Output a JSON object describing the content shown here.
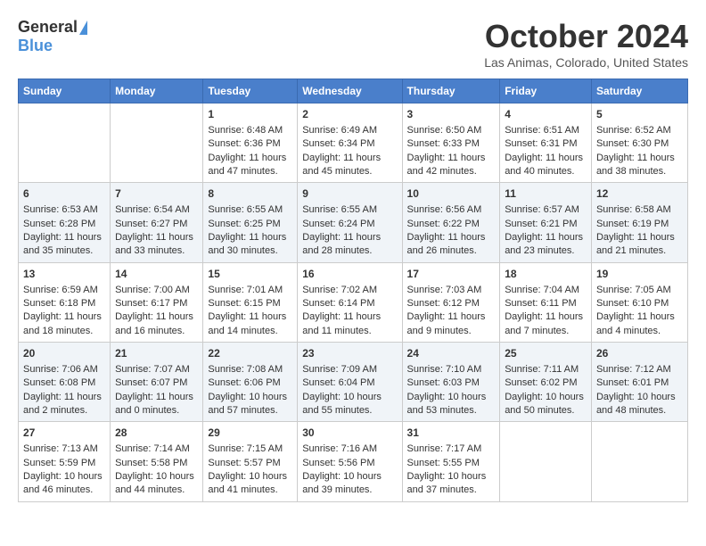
{
  "header": {
    "logo_general": "General",
    "logo_blue": "Blue",
    "month_title": "October 2024",
    "location": "Las Animas, Colorado, United States"
  },
  "days_of_week": [
    "Sunday",
    "Monday",
    "Tuesday",
    "Wednesday",
    "Thursday",
    "Friday",
    "Saturday"
  ],
  "weeks": [
    [
      {
        "day": "",
        "content": ""
      },
      {
        "day": "",
        "content": ""
      },
      {
        "day": "1",
        "content": "Sunrise: 6:48 AM\nSunset: 6:36 PM\nDaylight: 11 hours and 47 minutes."
      },
      {
        "day": "2",
        "content": "Sunrise: 6:49 AM\nSunset: 6:34 PM\nDaylight: 11 hours and 45 minutes."
      },
      {
        "day": "3",
        "content": "Sunrise: 6:50 AM\nSunset: 6:33 PM\nDaylight: 11 hours and 42 minutes."
      },
      {
        "day": "4",
        "content": "Sunrise: 6:51 AM\nSunset: 6:31 PM\nDaylight: 11 hours and 40 minutes."
      },
      {
        "day": "5",
        "content": "Sunrise: 6:52 AM\nSunset: 6:30 PM\nDaylight: 11 hours and 38 minutes."
      }
    ],
    [
      {
        "day": "6",
        "content": "Sunrise: 6:53 AM\nSunset: 6:28 PM\nDaylight: 11 hours and 35 minutes."
      },
      {
        "day": "7",
        "content": "Sunrise: 6:54 AM\nSunset: 6:27 PM\nDaylight: 11 hours and 33 minutes."
      },
      {
        "day": "8",
        "content": "Sunrise: 6:55 AM\nSunset: 6:25 PM\nDaylight: 11 hours and 30 minutes."
      },
      {
        "day": "9",
        "content": "Sunrise: 6:55 AM\nSunset: 6:24 PM\nDaylight: 11 hours and 28 minutes."
      },
      {
        "day": "10",
        "content": "Sunrise: 6:56 AM\nSunset: 6:22 PM\nDaylight: 11 hours and 26 minutes."
      },
      {
        "day": "11",
        "content": "Sunrise: 6:57 AM\nSunset: 6:21 PM\nDaylight: 11 hours and 23 minutes."
      },
      {
        "day": "12",
        "content": "Sunrise: 6:58 AM\nSunset: 6:19 PM\nDaylight: 11 hours and 21 minutes."
      }
    ],
    [
      {
        "day": "13",
        "content": "Sunrise: 6:59 AM\nSunset: 6:18 PM\nDaylight: 11 hours and 18 minutes."
      },
      {
        "day": "14",
        "content": "Sunrise: 7:00 AM\nSunset: 6:17 PM\nDaylight: 11 hours and 16 minutes."
      },
      {
        "day": "15",
        "content": "Sunrise: 7:01 AM\nSunset: 6:15 PM\nDaylight: 11 hours and 14 minutes."
      },
      {
        "day": "16",
        "content": "Sunrise: 7:02 AM\nSunset: 6:14 PM\nDaylight: 11 hours and 11 minutes."
      },
      {
        "day": "17",
        "content": "Sunrise: 7:03 AM\nSunset: 6:12 PM\nDaylight: 11 hours and 9 minutes."
      },
      {
        "day": "18",
        "content": "Sunrise: 7:04 AM\nSunset: 6:11 PM\nDaylight: 11 hours and 7 minutes."
      },
      {
        "day": "19",
        "content": "Sunrise: 7:05 AM\nSunset: 6:10 PM\nDaylight: 11 hours and 4 minutes."
      }
    ],
    [
      {
        "day": "20",
        "content": "Sunrise: 7:06 AM\nSunset: 6:08 PM\nDaylight: 11 hours and 2 minutes."
      },
      {
        "day": "21",
        "content": "Sunrise: 7:07 AM\nSunset: 6:07 PM\nDaylight: 11 hours and 0 minutes."
      },
      {
        "day": "22",
        "content": "Sunrise: 7:08 AM\nSunset: 6:06 PM\nDaylight: 10 hours and 57 minutes."
      },
      {
        "day": "23",
        "content": "Sunrise: 7:09 AM\nSunset: 6:04 PM\nDaylight: 10 hours and 55 minutes."
      },
      {
        "day": "24",
        "content": "Sunrise: 7:10 AM\nSunset: 6:03 PM\nDaylight: 10 hours and 53 minutes."
      },
      {
        "day": "25",
        "content": "Sunrise: 7:11 AM\nSunset: 6:02 PM\nDaylight: 10 hours and 50 minutes."
      },
      {
        "day": "26",
        "content": "Sunrise: 7:12 AM\nSunset: 6:01 PM\nDaylight: 10 hours and 48 minutes."
      }
    ],
    [
      {
        "day": "27",
        "content": "Sunrise: 7:13 AM\nSunset: 5:59 PM\nDaylight: 10 hours and 46 minutes."
      },
      {
        "day": "28",
        "content": "Sunrise: 7:14 AM\nSunset: 5:58 PM\nDaylight: 10 hours and 44 minutes."
      },
      {
        "day": "29",
        "content": "Sunrise: 7:15 AM\nSunset: 5:57 PM\nDaylight: 10 hours and 41 minutes."
      },
      {
        "day": "30",
        "content": "Sunrise: 7:16 AM\nSunset: 5:56 PM\nDaylight: 10 hours and 39 minutes."
      },
      {
        "day": "31",
        "content": "Sunrise: 7:17 AM\nSunset: 5:55 PM\nDaylight: 10 hours and 37 minutes."
      },
      {
        "day": "",
        "content": ""
      },
      {
        "day": "",
        "content": ""
      }
    ]
  ]
}
